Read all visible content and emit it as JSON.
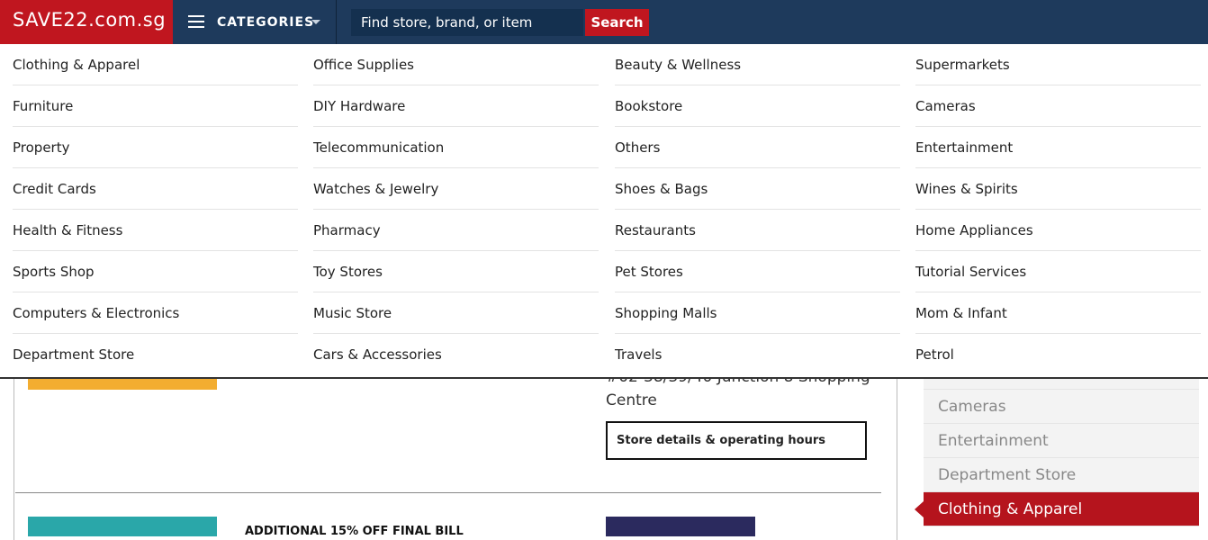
{
  "header": {
    "logo_text": "SAVE22.com.sg",
    "categories_label": "CATEGORIES",
    "search_placeholder": "Find store, brand, or item",
    "search_button": "Search",
    "colors": {
      "brand_red": "#c0161f",
      "navy": "#1e3a5c"
    }
  },
  "dropdown": {
    "columns": [
      [
        "Clothing & Apparel",
        "Furniture",
        "Property",
        "Credit Cards",
        "Health & Fitness",
        "Sports Shop",
        "Computers & Electronics",
        "Department Store"
      ],
      [
        "Office Supplies",
        "DIY Hardware",
        "Telecommunication",
        "Watches & Jewelry",
        "Pharmacy",
        "Toy Stores",
        "Music Store",
        "Cars & Accessories"
      ],
      [
        "Beauty & Wellness",
        "Bookstore",
        "Others",
        "Shoes & Bags",
        "Restaurants",
        "Pet Stores",
        "Shopping Malls",
        "Travels"
      ],
      [
        "Supermarkets",
        "Cameras",
        "Entertainment",
        "Wines & Spirits",
        "Home Appliances",
        "Tutorial Services",
        "Mom & Infant",
        "Petrol"
      ]
    ]
  },
  "background": {
    "address_lines": [
      "#02-38/39/40 Junction 8 Shopping",
      "Centre"
    ],
    "store_details_button": "Store details & operating hours",
    "promo_title": "ADDITIONAL 15% OFF FINAL BILL",
    "side_categories": [
      {
        "label": "",
        "active": false
      },
      {
        "label": "Cameras",
        "active": false
      },
      {
        "label": "Entertainment",
        "active": false
      },
      {
        "label": "Department Store",
        "active": false
      },
      {
        "label": "Clothing & Apparel",
        "active": true
      }
    ]
  }
}
